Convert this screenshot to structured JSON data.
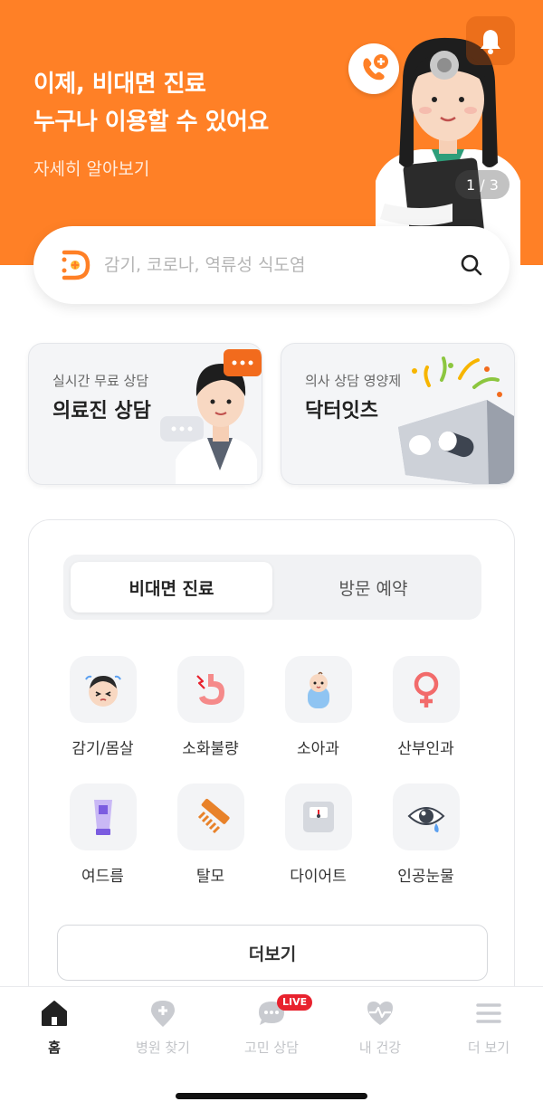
{
  "hero": {
    "title_line1": "이제, 비대면 진료",
    "title_line2": "누구나 이용할 수 있어요",
    "link": "자세히 알아보기",
    "pager": "1 / 3",
    "background": "#FF8026"
  },
  "search": {
    "placeholder": "감기, 코로나, 역류성 식도염"
  },
  "cards": [
    {
      "subtitle": "실시간 무료 상담",
      "title": "의료진 상담"
    },
    {
      "subtitle": "의사 상담 영양제",
      "title": "닥터잇츠"
    }
  ],
  "segment": {
    "tabs": [
      "비대면 진료",
      "방문 예약"
    ],
    "selected": "비대면 진료"
  },
  "categories": [
    {
      "label": "감기/몸살",
      "icon": "sick-face-icon"
    },
    {
      "label": "소화불량",
      "icon": "stomach-icon"
    },
    {
      "label": "소아과",
      "icon": "baby-icon"
    },
    {
      "label": "산부인과",
      "icon": "female-symbol-icon"
    },
    {
      "label": "여드름",
      "icon": "cream-tube-icon"
    },
    {
      "label": "탈모",
      "icon": "comb-icon"
    },
    {
      "label": "다이어트",
      "icon": "scale-icon"
    },
    {
      "label": "인공눈물",
      "icon": "eye-drop-icon"
    }
  ],
  "more_button": "더보기",
  "tabbar": {
    "items": [
      {
        "label": "홈",
        "icon": "home-icon"
      },
      {
        "label": "병원 찾기",
        "icon": "hospital-pin-icon"
      },
      {
        "label": "고민 상담",
        "icon": "chat-bubble-icon"
      },
      {
        "label": "내 건강",
        "icon": "heart-pulse-icon"
      },
      {
        "label": "더 보기",
        "icon": "menu-icon"
      }
    ],
    "active": "홈",
    "badge": "LIVE"
  },
  "colors": {
    "accent": "#FF8026",
    "live": "#E8222E"
  }
}
